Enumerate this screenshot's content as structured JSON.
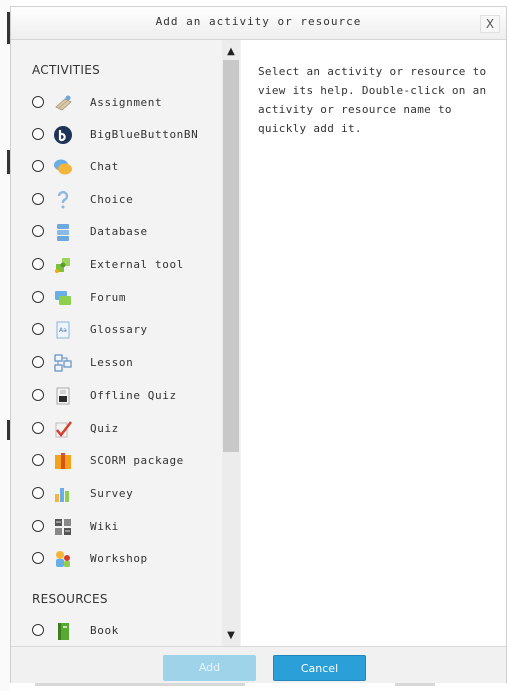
{
  "dialog": {
    "title": "Add an activity or resource",
    "close_label": "X",
    "help_text": "Select an activity or resource to view its help. Double-click on an activity or resource name to quickly add it."
  },
  "activities": {
    "heading": "ACTIVITIES",
    "items": [
      {
        "label": "Assignment",
        "icon": "assignment-icon"
      },
      {
        "label": "BigBlueButtonBN",
        "icon": "bigbluebutton-icon"
      },
      {
        "label": "Chat",
        "icon": "chat-icon"
      },
      {
        "label": "Choice",
        "icon": "choice-icon"
      },
      {
        "label": "Database",
        "icon": "database-icon"
      },
      {
        "label": "External tool",
        "icon": "external-tool-icon"
      },
      {
        "label": "Forum",
        "icon": "forum-icon"
      },
      {
        "label": "Glossary",
        "icon": "glossary-icon"
      },
      {
        "label": "Lesson",
        "icon": "lesson-icon"
      },
      {
        "label": "Offline Quiz",
        "icon": "offline-quiz-icon"
      },
      {
        "label": "Quiz",
        "icon": "quiz-icon"
      },
      {
        "label": "SCORM package",
        "icon": "scorm-icon"
      },
      {
        "label": "Survey",
        "icon": "survey-icon"
      },
      {
        "label": "Wiki",
        "icon": "wiki-icon"
      },
      {
        "label": "Workshop",
        "icon": "workshop-icon"
      }
    ]
  },
  "resources": {
    "heading": "RESOURCES",
    "items": [
      {
        "label": "Book",
        "icon": "book-icon"
      }
    ]
  },
  "footer": {
    "add_label": "Add",
    "cancel_label": "Cancel"
  },
  "colors": {
    "accent": "#2b9fd8",
    "accent_disabled": "#9ed3ea"
  }
}
